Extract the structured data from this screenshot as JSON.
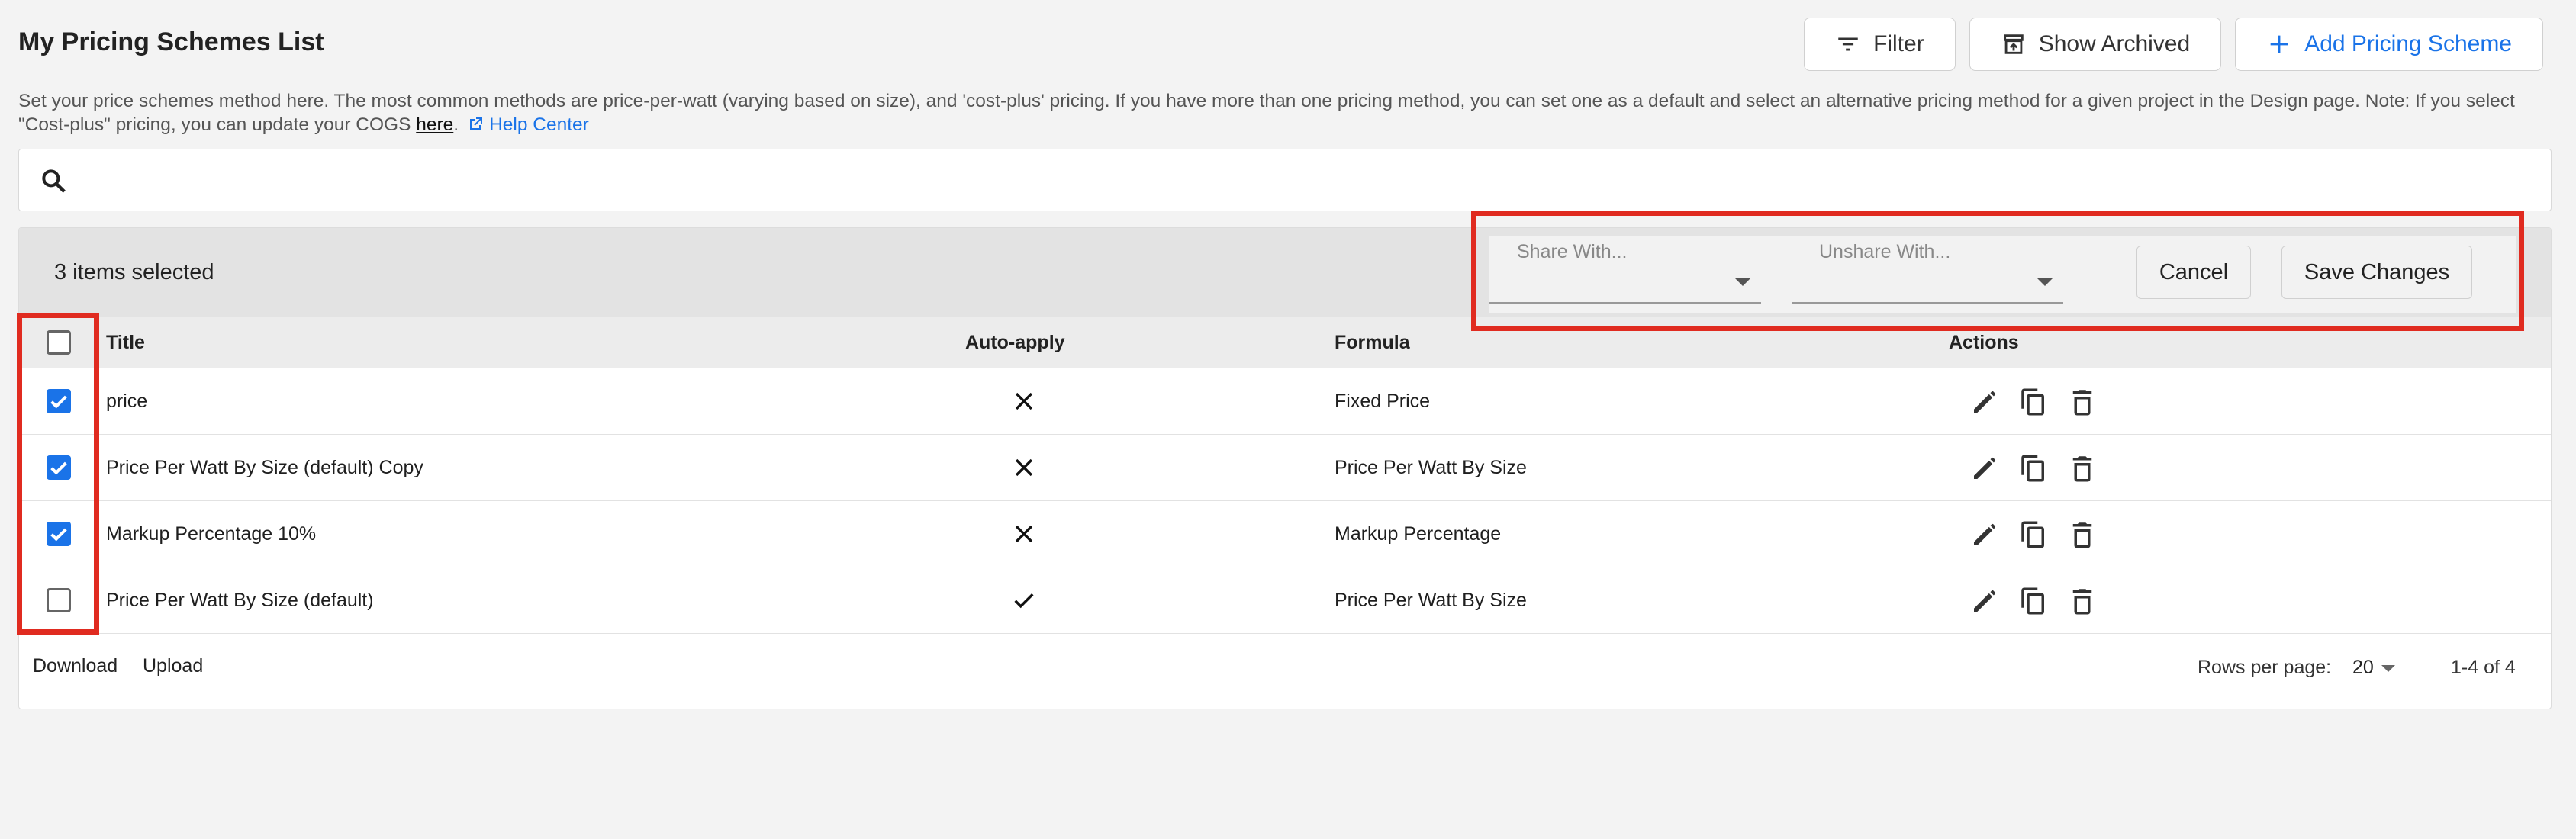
{
  "header": {
    "title": "My Pricing Schemes List",
    "filter_label": "Filter",
    "show_archived_label": "Show Archived",
    "add_label": "Add Pricing Scheme"
  },
  "description": {
    "text": "Set your price schemes method here. The most common methods are price-per-watt (varying based on size), and 'cost-plus' pricing. If you have more than one pricing method, you can set one as a default and select an alternative pricing method for a given project in the Design page. Note: If you select \"Cost-plus\" pricing, you can update your COGS ",
    "link": "here",
    "help_label": "Help Center"
  },
  "search": {
    "icon": "search-icon"
  },
  "selection": {
    "count_label": "3 items selected",
    "share_label": "Share With...",
    "unshare_label": "Unshare With...",
    "cancel_label": "Cancel",
    "save_label": "Save Changes"
  },
  "table": {
    "headers": {
      "title": "Title",
      "auto_apply": "Auto-apply",
      "formula": "Formula",
      "actions": "Actions"
    },
    "rows": [
      {
        "title": "price",
        "auto_apply": false,
        "formula": "Fixed Price",
        "selected": true
      },
      {
        "title": "Price Per Watt By Size (default) Copy",
        "auto_apply": false,
        "formula": "Price Per Watt By Size",
        "selected": true
      },
      {
        "title": "Markup Percentage 10%",
        "auto_apply": false,
        "formula": "Markup Percentage",
        "selected": true
      },
      {
        "title": "Price Per Watt By Size (default)",
        "auto_apply": true,
        "formula": "Price Per Watt By Size",
        "selected": false
      }
    ]
  },
  "footer": {
    "download_label": "Download",
    "upload_label": "Upload",
    "rows_per_page_label": "Rows per page:",
    "rows_per_page_value": "20",
    "range_label": "1-4 of 4"
  },
  "colors": {
    "accent": "#1a73e8",
    "highlight": "#e02b20"
  }
}
